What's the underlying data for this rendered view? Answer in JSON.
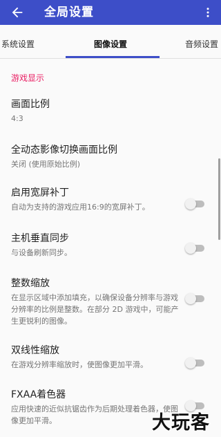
{
  "appbar": {
    "title": "全局设置",
    "back_icon": "arrow-back-icon",
    "more_icon": "more-vert-icon",
    "color": "#3d4ec8"
  },
  "tabs": [
    {
      "label": "系统设置",
      "selected": false
    },
    {
      "label": "图像设置",
      "selected": true
    },
    {
      "label": "音频设置",
      "selected": false
    }
  ],
  "section": {
    "header": "游戏显示",
    "accent": "#e91e63"
  },
  "items": [
    {
      "title": "画面比例",
      "summary": "4:3"
    },
    {
      "title": "全动态影像切换画面比例",
      "summary": "关闭 (使用原始比例)"
    },
    {
      "title": "启用宽屏补丁",
      "summary": "自动为支持的游戏应用16:9的宽屏补丁。",
      "toggle": false
    },
    {
      "title": "主机垂直同步",
      "summary": "与设备刷新同步。",
      "toggle": false
    },
    {
      "title": "整数缩放",
      "summary": "在显示区域中添加填充，以确保设备分辨率与游戏分辨率的比例是整数。在部分 2D 游戏中，可能产生更锐利的图像。",
      "toggle": false
    },
    {
      "title": "双线性缩放",
      "summary": "在游戏分辨率缩放时，使图像更加平滑。",
      "toggle": false
    },
    {
      "title": "FXAA着色器",
      "summary": "应用快速的近似抗锯齿作为后期处理着色器，使图像更加平滑。",
      "toggle": false
    }
  ],
  "watermark": "大玩客"
}
